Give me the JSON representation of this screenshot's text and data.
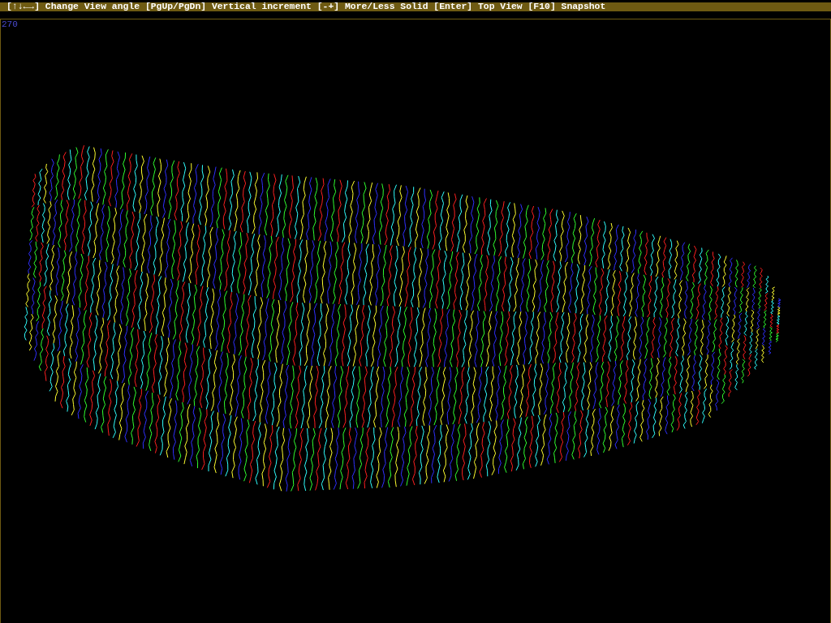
{
  "help_bar": {
    "text": "[↑↓←→] Change View angle [PgUp/PgDn] Vertical increment [-+] More/Less Solid [Enter] Top View [F10] Snapshot"
  },
  "viewport": {
    "angle": "270"
  }
}
